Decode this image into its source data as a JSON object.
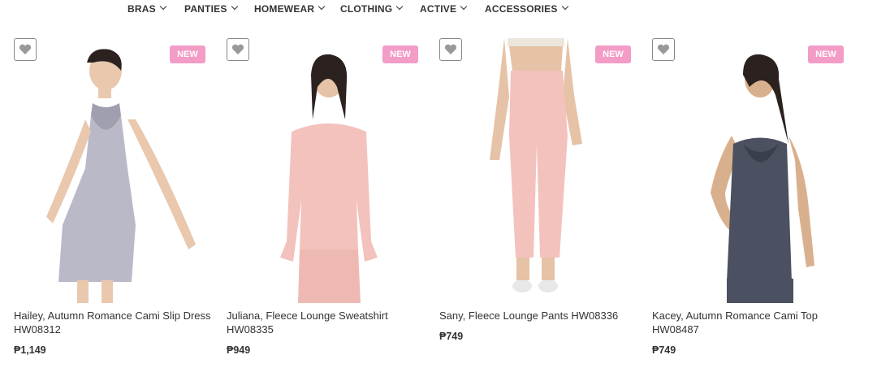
{
  "nav": {
    "items": [
      "BRAS",
      "PANTIES",
      "HOMEWEAR",
      "CLOTHING",
      "ACTIVE",
      "ACCESSORIES"
    ]
  },
  "products": [
    {
      "badge": "NEW",
      "name": "Hailey, Autumn Romance Cami Slip Dress HW08312",
      "price": "₱1,149",
      "garment_color": "#b9b9c8"
    },
    {
      "badge": "NEW",
      "name": "Juliana, Fleece Lounge Sweatshirt HW08335",
      "price": "₱949",
      "garment_color": "#f3c2bd"
    },
    {
      "badge": "NEW",
      "name": "Sany, Fleece Lounge Pants HW08336",
      "price": "₱749",
      "garment_color": "#f3c2bd"
    },
    {
      "badge": "NEW",
      "name": "Kacey, Autumn Romance Cami Top HW08487",
      "price": "₱749",
      "garment_color": "#4b5161"
    }
  ],
  "colors": {
    "badge": "#f29cc6",
    "text": "#333333",
    "wishlist_icon": "#999999"
  },
  "icons": {
    "wishlist": "heart-icon",
    "dropdown": "chevron-down-icon"
  }
}
